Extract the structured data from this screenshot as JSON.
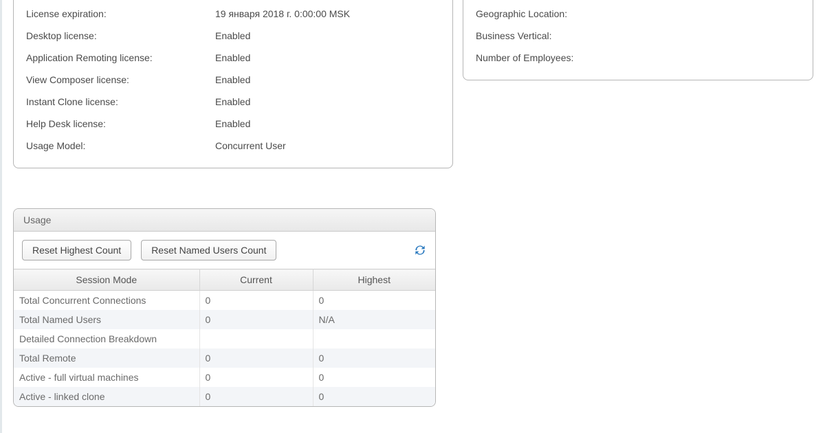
{
  "license": {
    "rows": [
      {
        "label": "License expiration:",
        "value": "19 января 2018 г. 0:00:00 MSK"
      },
      {
        "label": "Desktop license:",
        "value": "Enabled"
      },
      {
        "label": "Application Remoting license:",
        "value": "Enabled"
      },
      {
        "label": "View Composer license:",
        "value": "Enabled"
      },
      {
        "label": "Instant Clone license:",
        "value": "Enabled"
      },
      {
        "label": "Help Desk license:",
        "value": "Enabled"
      },
      {
        "label": "Usage Model:",
        "value": "Concurrent User"
      }
    ]
  },
  "customer": {
    "rows": [
      {
        "label": "Geographic Location:",
        "value": ""
      },
      {
        "label": "Business Vertical:",
        "value": ""
      },
      {
        "label": "Number of Employees:",
        "value": ""
      }
    ]
  },
  "usage": {
    "title": "Usage",
    "buttons": {
      "reset_highest": "Reset Highest Count",
      "reset_named": "Reset Named Users Count"
    },
    "columns": {
      "mode": "Session Mode",
      "current": "Current",
      "highest": "Highest"
    },
    "rows": [
      {
        "mode": "Total Concurrent Connections",
        "current": "0",
        "highest": "0",
        "indent": false
      },
      {
        "mode": "Total Named Users",
        "current": "0",
        "highest": "N/A",
        "indent": false
      },
      {
        "mode": "Detailed Connection Breakdown",
        "current": "",
        "highest": "",
        "indent": false
      },
      {
        "mode": "Total Remote",
        "current": "0",
        "highest": "0",
        "indent": false
      },
      {
        "mode": "Active - full virtual machines",
        "current": "0",
        "highest": "0",
        "indent": true
      },
      {
        "mode": "Active - linked clone",
        "current": "0",
        "highest": "0",
        "indent": true
      }
    ]
  }
}
